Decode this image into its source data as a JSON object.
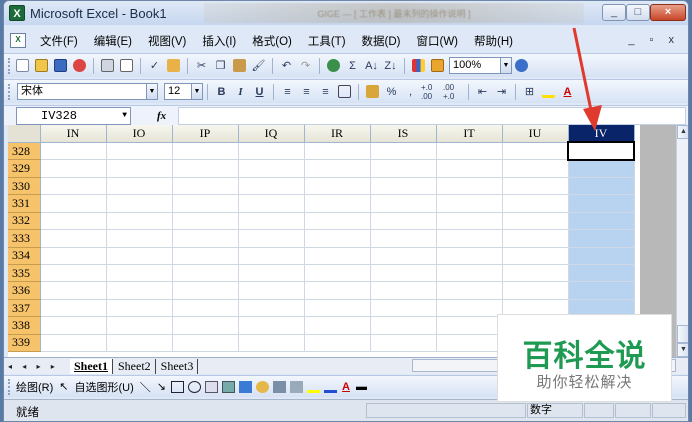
{
  "window": {
    "title": "Microsoft Excel - Book1",
    "app_icon": "X",
    "blurred_text": "GIGE — [ 工作表 ] 最末列的操作说明 ]",
    "controls": [
      "_",
      "□",
      "×"
    ]
  },
  "menu": {
    "items": [
      "文件(F)",
      "编辑(E)",
      "视图(V)",
      "插入(I)",
      "格式(O)",
      "工具(T)",
      "数据(D)",
      "窗口(W)",
      "帮助(H)"
    ],
    "doc_controls": "_ ▫ x"
  },
  "toolbar_standard": {
    "zoom": "100%",
    "sigma": "Σ"
  },
  "toolbar_format": {
    "font": "宋体",
    "size": "12",
    "bold": "B",
    "italic": "I",
    "underline": "U",
    "percent": "%",
    "comma": ",",
    "inc_dec": "+.0 .00",
    "dec_dec": ".00 +.0"
  },
  "formula_bar": {
    "name_box": "IV328",
    "fx": "fx",
    "content": ""
  },
  "grid": {
    "columns": [
      "IN",
      "IO",
      "IP",
      "IQ",
      "IR",
      "IS",
      "IT",
      "IU",
      "IV"
    ],
    "selected_column": "IV",
    "rows": [
      "328",
      "329",
      "330",
      "331",
      "332",
      "333",
      "334",
      "335",
      "336",
      "337",
      "338",
      "339"
    ],
    "active_cell": "IV328"
  },
  "sheets": {
    "nav": "◂ ◂ ▸ ▸",
    "tabs": [
      "Sheet1",
      "Sheet2",
      "Sheet3"
    ],
    "active": "Sheet1"
  },
  "draw_toolbar": {
    "draw": "绘图(R)",
    "autoshapes": "自选图形(U)"
  },
  "status": {
    "ready": "就绪",
    "num": "数字"
  },
  "watermark": {
    "title": "百科全说",
    "subtitle": "助你轻松解决"
  },
  "colors": {
    "selected_header": "#0a246a",
    "selected_column": "#b8d3f0",
    "row_header": "#f6c36b",
    "arrow": "#e03a2e",
    "watermark": "#1f9a52"
  }
}
